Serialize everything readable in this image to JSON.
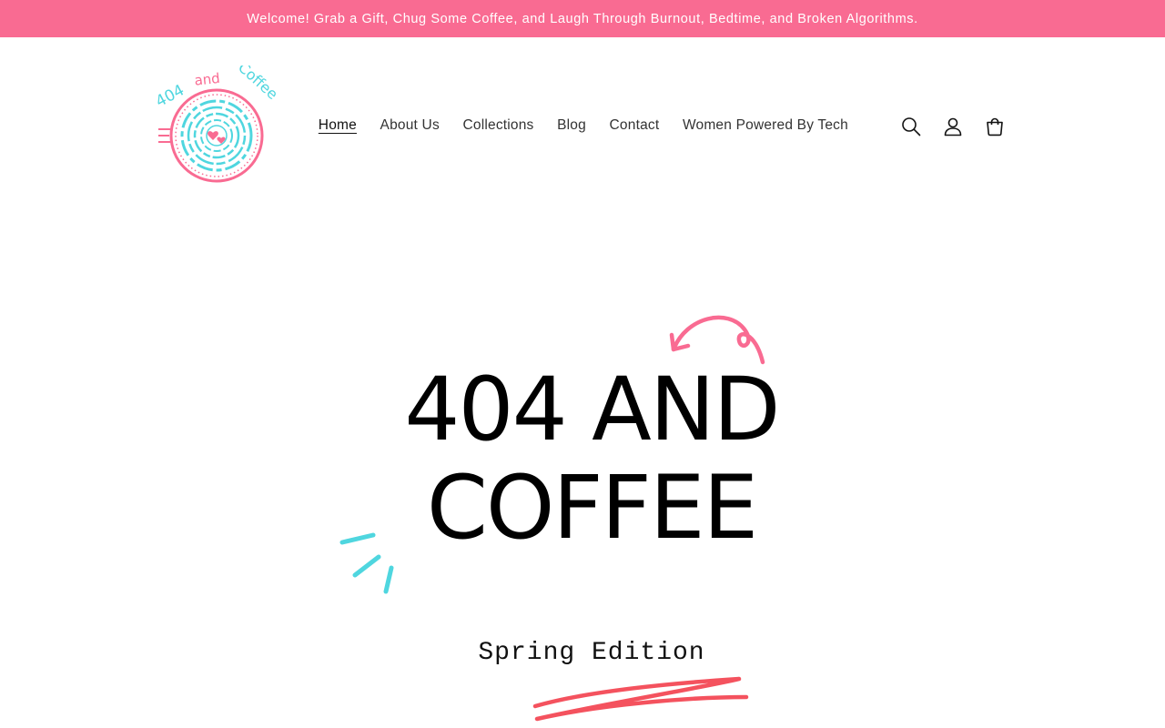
{
  "announcement": {
    "text": "Welcome! Grab a Gift, Chug Some Coffee, and Laugh Through Burnout, Bedtime, and Broken Algorithms."
  },
  "logo": {
    "text": "404 and Coffee",
    "icon": "coffee-cup-target-logo",
    "colors": {
      "pink": "#f96b92",
      "teal": "#4fd6df"
    }
  },
  "nav": {
    "items": [
      {
        "label": "Home",
        "active": true
      },
      {
        "label": "About Us"
      },
      {
        "label": "Collections"
      },
      {
        "label": "Blog"
      },
      {
        "label": "Contact"
      },
      {
        "label": "Women Powered By Tech"
      }
    ]
  },
  "header_icons": {
    "search": "search-icon",
    "account": "account-icon",
    "cart": "cart-icon"
  },
  "hero": {
    "title_line1": "404 AND",
    "title_line2": "COFFEE",
    "subtitle": "Spring Edition"
  },
  "colors": {
    "accent_pink": "#f96b92",
    "accent_teal": "#4fd6df",
    "underline_red": "#f4525e"
  }
}
